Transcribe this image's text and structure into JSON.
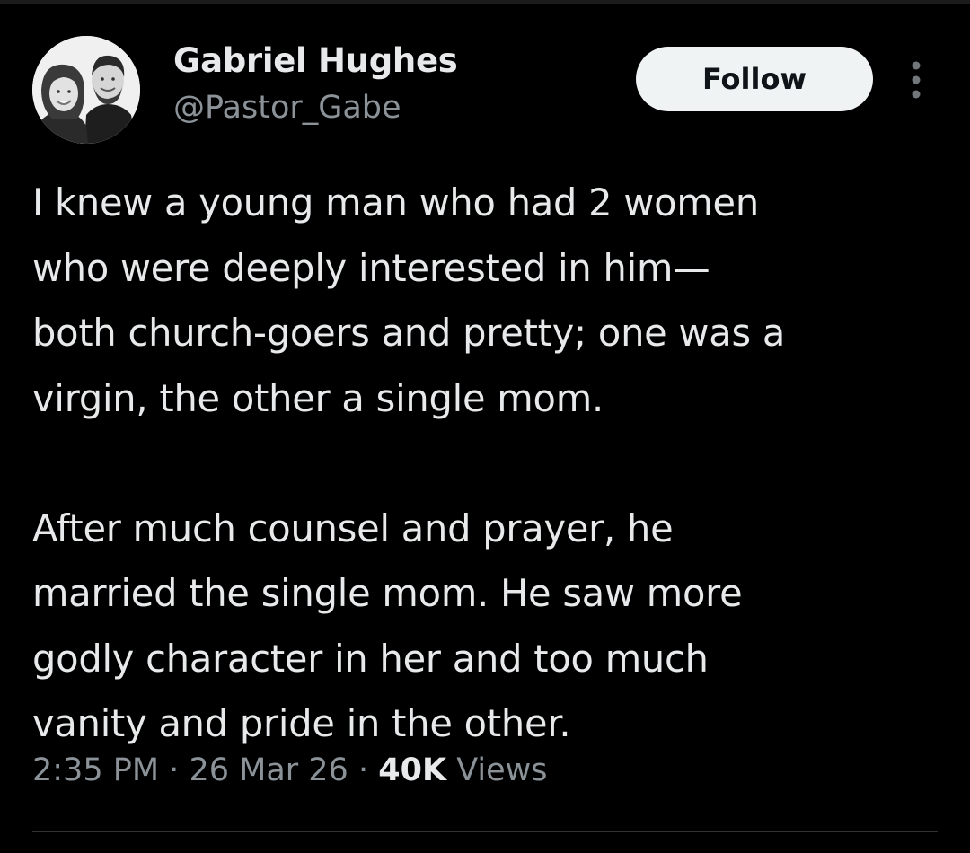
{
  "author": {
    "name": "Gabriel Hughes",
    "handle": "@Pastor_Gabe",
    "avatar_icon": "profile-photo-couple"
  },
  "actions": {
    "follow_label": "Follow",
    "more_icon": "vertical-ellipsis-icon"
  },
  "tweet": {
    "paragraph1_lines": [
      "I knew a young man who had 2 women",
      "who were deeply interested in him—",
      "both church-goers and pretty; one was a",
      "virgin, the other a single mom."
    ],
    "paragraph2_lines": [
      "After much counsel and prayer, he",
      "married the single mom. He saw more",
      "godly character in her and too much",
      "vanity and pride in the other."
    ]
  },
  "meta": {
    "time": "2:35 PM",
    "date": "26 Mar 26",
    "separator": "·",
    "views_count": "40K",
    "views_label": "Views"
  },
  "colors": {
    "background": "#000000",
    "primary_text": "#e7e9ea",
    "secondary_text": "#8b9298",
    "follow_button_bg": "#eff3f4",
    "follow_button_text": "#0f1419",
    "divider": "#2f3336"
  }
}
